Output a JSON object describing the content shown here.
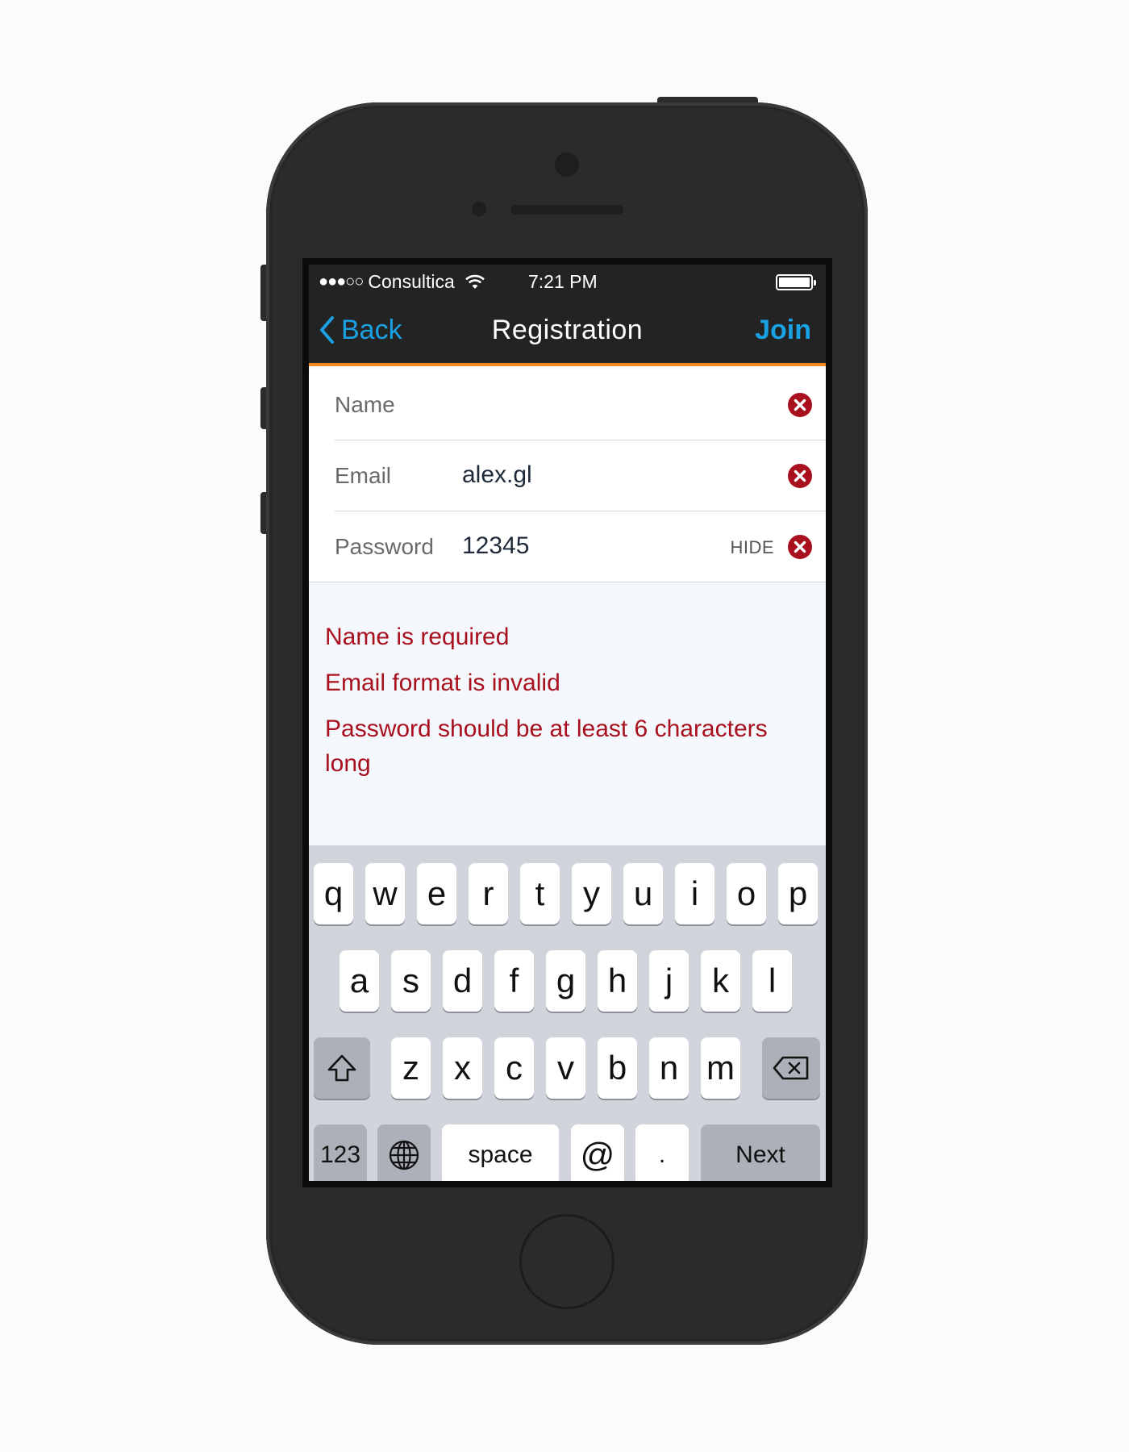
{
  "status_bar": {
    "signal": "●●●○○",
    "carrier": "Consultica",
    "time": "7:21 PM"
  },
  "nav": {
    "back_label": "Back",
    "title": "Registration",
    "join_label": "Join",
    "accent_color": "#1aa1e4",
    "underline_color": "#f08a22"
  },
  "form": {
    "name": {
      "label": "Name",
      "value": ""
    },
    "email": {
      "label": "Email",
      "value": "alex.gl"
    },
    "password": {
      "label": "Password",
      "value": "12345",
      "toggle_label": "HIDE"
    }
  },
  "errors": {
    "name": "Name is required",
    "email": "Email format is invalid",
    "password": "Password should be at least 6 characters long",
    "color": "#a8101e"
  },
  "keyboard": {
    "row1": [
      "q",
      "w",
      "e",
      "r",
      "t",
      "y",
      "u",
      "i",
      "o",
      "p"
    ],
    "row2": [
      "a",
      "s",
      "d",
      "f",
      "g",
      "h",
      "j",
      "k",
      "l"
    ],
    "row3": [
      "z",
      "x",
      "c",
      "v",
      "b",
      "n",
      "m"
    ],
    "numbers": "123",
    "space": "space",
    "at": "@",
    "dot": ".",
    "next": "Next",
    "icons": [
      "shift-icon",
      "backspace-icon",
      "globe-icon"
    ]
  }
}
